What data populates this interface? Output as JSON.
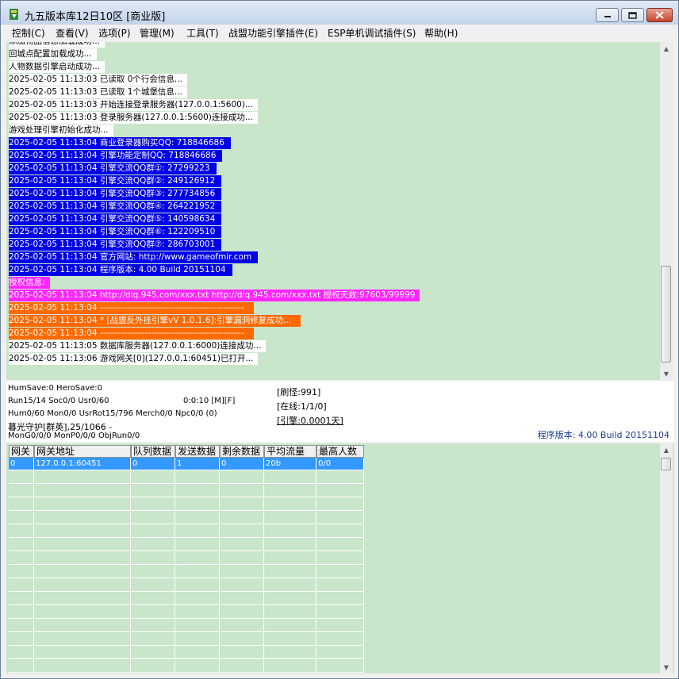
{
  "window": {
    "title": "九五版本库12日10区 [商业版]"
  },
  "menu": [
    "控制(C)",
    "查看(V)",
    "选项(P)",
    "管理(M)",
    "工具(T)",
    "战盟功能引擎插件(E)",
    "ESP单机调试插件(S)",
    "帮助(H)"
  ],
  "log_lines": [
    {
      "text": "添加物品信息加载成功...",
      "style": "white"
    },
    {
      "text": "回城点配置加载成功...",
      "style": "white"
    },
    {
      "text": "人物数据引擎启动成功...",
      "style": "white"
    },
    {
      "text": "2025-02-05 11:13:03 已读取 0个行会信息...",
      "style": "white"
    },
    {
      "text": "2025-02-05 11:13:03 已读取 1个城堡信息...",
      "style": "white"
    },
    {
      "text": "2025-02-05 11:13:03 开始连接登录服务器(127.0.0.1:5600)...",
      "style": "white"
    },
    {
      "text": "2025-02-05 11:13:03 登录服务器(127.0.0.1:5600)连接成功...",
      "style": "white"
    },
    {
      "text": "游戏处理引擎初始化成功...",
      "style": "white"
    },
    {
      "text": "2025-02-05 11:13:04 商业登录器购买QQ: 718846686",
      "style": "blue"
    },
    {
      "text": "2025-02-05 11:13:04 引擎功能定制QQ: 718846686",
      "style": "blue"
    },
    {
      "text": "2025-02-05 11:13:04 引擎交流QQ群①: 27299223",
      "style": "blue"
    },
    {
      "text": "2025-02-05 11:13:04 引擎交流QQ群②: 249126912",
      "style": "blue"
    },
    {
      "text": "2025-02-05 11:13:04 引擎交流QQ群③: 277734856",
      "style": "blue"
    },
    {
      "text": "2025-02-05 11:13:04 引擎交流QQ群④: 264221952",
      "style": "blue"
    },
    {
      "text": "2025-02-05 11:13:04 引擎交流QQ群⑤: 140598634",
      "style": "blue"
    },
    {
      "text": "2025-02-05 11:13:04 引擎交流QQ群⑥: 122209510",
      "style": "blue"
    },
    {
      "text": "2025-02-05 11:13:04 引擎交流QQ群⑦: 286703001",
      "style": "blue"
    },
    {
      "text": "2025-02-05 11:13:04 官方网站: http://www.gameofmir.com",
      "style": "blue"
    },
    {
      "text": "2025-02-05 11:13:04 程序版本: 4.00 Build 20151104",
      "style": "blue"
    },
    {
      "text": "授权信息:",
      "style": "magenta"
    },
    {
      "text": "2025-02-05 11:13:04 http://dlq.945.com/xxx.txt http://dlq.945.com/xxx.txt 授权天数:97603/99999",
      "style": "magenta"
    },
    {
      "text": "2025-02-05 11:13:04 ------------------------------------------------",
      "style": "orange"
    },
    {
      "text": "2025-02-05 11:13:04 * [战盟反外挂引擎vV 1.0.1.6]:引擎漏洞修复成功...",
      "style": "orange"
    },
    {
      "text": "2025-02-05 11:13:04 ------------------------------------------------",
      "style": "orange"
    },
    {
      "text": "2025-02-05 11:13:05 数据库服务器(127.0.0.1:6000)连接成功...",
      "style": "white"
    },
    {
      "text": "2025-02-05 11:13:06 游戏网关[0](127.0.0.1:60451)已打开...",
      "style": "white"
    }
  ],
  "status": {
    "humsave": "HumSave:0 HeroSave:0",
    "run": "Run15/14 Soc0/0 Usr0/60",
    "timer": "0:0:10 [M][F]",
    "hum": "Hum0/60 Mon0/0 UsrRot15/796 Merch0/0 Npc0/0 (0)",
    "guard": "暮光守护[群英],25/1066 -",
    "mong": "MonG0/0/0 MonP0/0/0 ObjRun0/0",
    "refresh": "[刷怪:991]",
    "online": "[在线:1/1/0]",
    "engine": "[引擎:0.0001天]",
    "program_version": "程序版本: 4.00 Build 20151104"
  },
  "gateway_table": {
    "columns": [
      "网关",
      "网关地址",
      "队列数据",
      "发送数据",
      "剩余数据",
      "平均流量",
      "最高人数"
    ],
    "rows": [
      [
        "0",
        "127.0.0.1:60451",
        "0",
        "1",
        "0",
        "20b",
        "0/0"
      ]
    ]
  }
}
